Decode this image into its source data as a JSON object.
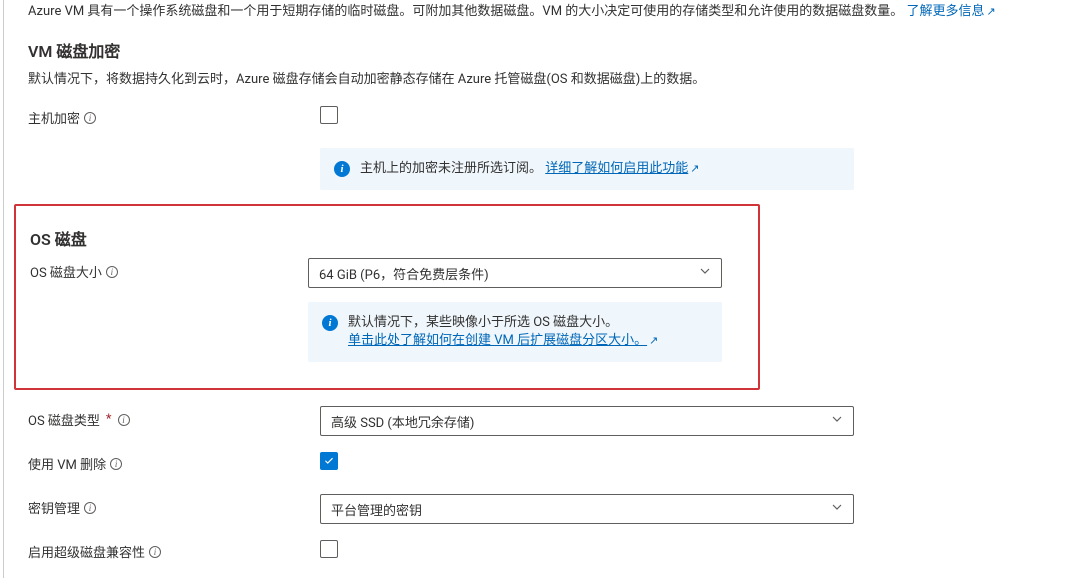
{
  "intro": {
    "text_a": "Azure VM 具有一个操作系统磁盘和一个用于短期存储的临时磁盘。可附加其他数据磁盘。VM 的大小决定可使用的存储类型和允许使用的数据磁盘数量。",
    "learn_more": "了解更多信息"
  },
  "encryption": {
    "title": "VM 磁盘加密",
    "desc": "默认情况下，将数据持久化到云时，Azure 磁盘存储会自动加密静态存储在 Azure 托管磁盘(OS 和数据磁盘)上的数据。",
    "host_label": "主机加密",
    "host_checked": false,
    "banner_text": "主机上的加密未注册所选订阅。",
    "banner_link": "详细了解如何启用此功能"
  },
  "os_disk": {
    "title": "OS 磁盘",
    "size_label": "OS 磁盘大小",
    "size_value": "64 GiB (P6，符合免费层条件)",
    "banner_line1": "默认情况下，某些映像小于所选 OS 磁盘大小。",
    "banner_link": "单击此处了解如何在创建 VM 后扩展磁盘分区大小。",
    "type_label": "OS 磁盘类型",
    "type_value": "高级 SSD (本地冗余存储)",
    "delete_label": "使用 VM 删除",
    "delete_checked": true,
    "key_label": "密钥管理",
    "key_value": "平台管理的密钥",
    "ultra_label_partial": "启用超级磁盘兼容性"
  }
}
